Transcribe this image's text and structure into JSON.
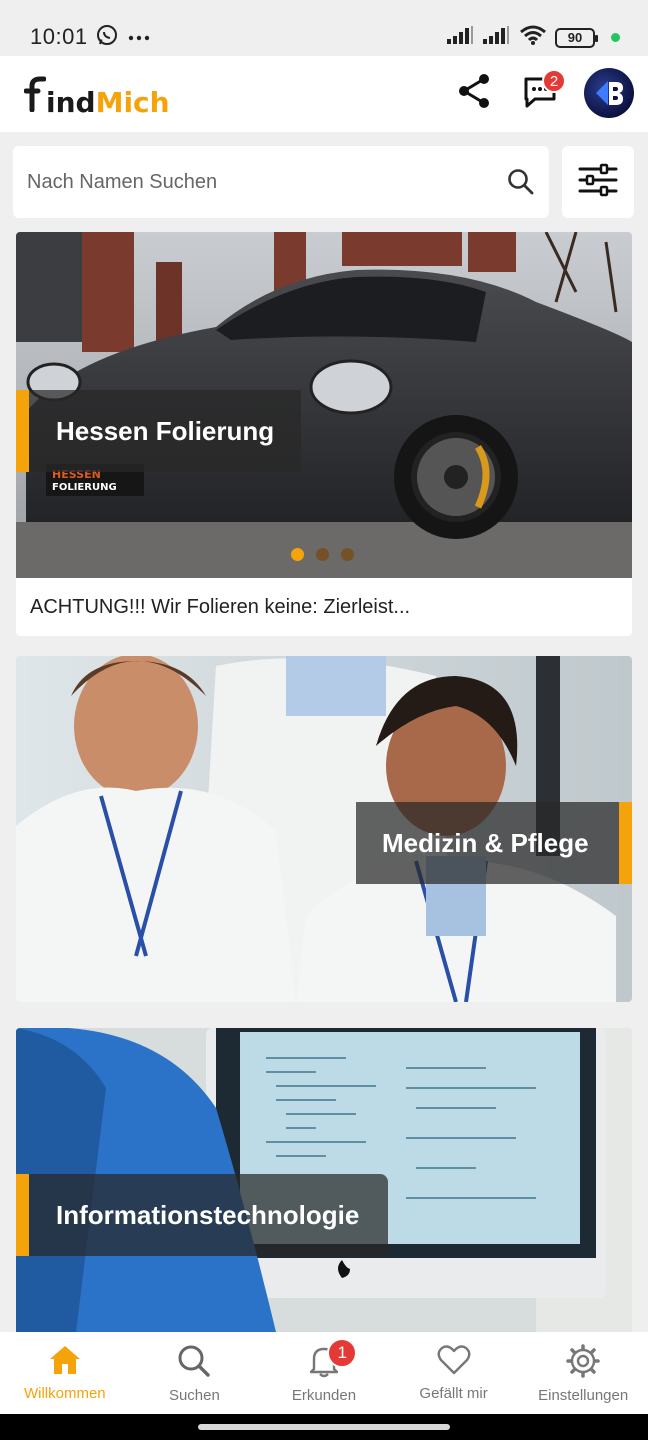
{
  "status_bar": {
    "time": "10:01",
    "battery": "90"
  },
  "header": {
    "logo_part1": "indMich",
    "logo_part1_display": "ind",
    "logo_part2": "Mich",
    "notification_count": "2"
  },
  "search": {
    "placeholder": "Nach Namen Suchen"
  },
  "cards": [
    {
      "title": "Hessen Folierung",
      "caption": "ACHTUNG!!! Wir Folieren keine: Zierleist...",
      "image_text": "HESSEN FOLIERUNG"
    },
    {
      "title": "Medizin & Pflege"
    },
    {
      "title": "Informationstechnologie"
    }
  ],
  "carousel": {
    "total": 3,
    "active": 1
  },
  "bottom_nav": {
    "items": [
      {
        "label": "Willkommen",
        "icon": "home-icon",
        "active": true
      },
      {
        "label": "Suchen",
        "icon": "search-icon"
      },
      {
        "label": "Erkunden",
        "icon": "bell-icon",
        "badge": "1"
      },
      {
        "label": "Gefällt mir",
        "icon": "heart-icon"
      },
      {
        "label": "Einstellungen",
        "icon": "gear-icon"
      }
    ]
  },
  "colors": {
    "accent": "#f5a30a",
    "badge": "#e53935",
    "background": "#efefef"
  }
}
